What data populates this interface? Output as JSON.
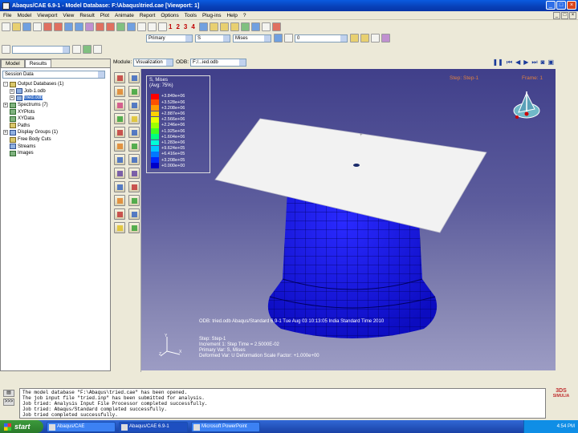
{
  "window": {
    "title": "Abaqus/CAE 6.9-1 - Model Database: F:\\Abaqus\\tried.cae [Viewport: 1]",
    "buttons": [
      "_",
      "□",
      "×"
    ]
  },
  "menu": [
    "File",
    "Model",
    "Viewport",
    "View",
    "Result",
    "Plot",
    "Animate",
    "Report",
    "Options",
    "Tools",
    "Plug-ins",
    "Help",
    "?"
  ],
  "toolbar": {
    "view_numbers": [
      "1",
      "2",
      "3",
      "4"
    ],
    "variable_type": "Primary",
    "field": "S",
    "invariant": "Mises",
    "render_value": "0"
  },
  "context": {
    "module_label": "Module:",
    "module_value": "Visualization",
    "odb_label": "ODB:",
    "odb_value": "F:/...ied.odb"
  },
  "tree": {
    "tabs": [
      "Model",
      "Results"
    ],
    "filter": "Session Data",
    "items": [
      {
        "label": "Output Databases (1)",
        "level": 0,
        "icon": "database-icon"
      },
      {
        "label": "Job-1.odb",
        "level": 1,
        "icon": "odb-icon"
      },
      {
        "label": "tried.odb",
        "level": 1,
        "icon": "odb-icon"
      },
      {
        "label": "Spectrums (7)",
        "level": 0,
        "icon": "spectrum-icon"
      },
      {
        "label": "XYPlots",
        "level": 0,
        "icon": "xyplot-icon"
      },
      {
        "label": "XYData",
        "level": 0,
        "icon": "xydata-icon"
      },
      {
        "label": "Paths",
        "level": 0,
        "icon": "path-icon"
      },
      {
        "label": "Display Groups (1)",
        "level": 0,
        "icon": "display-group-icon"
      },
      {
        "label": "Free Body Cuts",
        "level": 0,
        "icon": "free-body-icon"
      },
      {
        "label": "Streams",
        "level": 0,
        "icon": "stream-icon"
      },
      {
        "label": "Images",
        "level": 0,
        "icon": "image-icon"
      }
    ]
  },
  "legend": {
    "title": "S, Mises",
    "subtitle": "(Avg: 75%)",
    "values": [
      "+3.849e+06",
      "+3.528e+06",
      "+3.208e+06",
      "+2.887e+06",
      "+2.566e+06",
      "+2.246e+06",
      "+1.925e+06",
      "+1.604e+06",
      "+1.283e+06",
      "+9.624e+05",
      "+6.416e+05",
      "+3.208e+05",
      "+0.000e+00"
    ],
    "colors": [
      "#ff0000",
      "#ff5000",
      "#ff9a00",
      "#ffd000",
      "#e8ff00",
      "#9cff00",
      "#40ff20",
      "#00ff80",
      "#00ffd8",
      "#00c8ff",
      "#0078ff",
      "#0028ff",
      "#0000c8"
    ]
  },
  "viewport": {
    "step_label": "Step: Step-1",
    "frame_label": "Frame: 1",
    "odb_info": "ODB: tried.odb    Abaqus/Standard 6.9-1    Tue Aug 03 10:13:05 India Standard Time 2010",
    "step_info": "Step: Step-1",
    "increment_info": "Increment      1: Step Time =    2.5000E-02",
    "primary_var": "Primary Var: S, Mises",
    "deformed_var": "Deformed Var: U   Deformation Scale Factor: +1.000e+00"
  },
  "messages": [
    "The model database \"F:\\Abaqus\\tried.cae\" has been opened.",
    "The job input file \"tried.inp\" has been submitted for analysis.",
    "Job tried: Analysis Input File Processor completed successfully.",
    "Job tried: Abaqus/Standard completed successfully.",
    "Job tried completed successfully."
  ],
  "brand": {
    "logo": "3DS",
    "name": "SIMULIA"
  },
  "taskbar": {
    "start": "start",
    "tasks": [
      "Abaqus/CAE",
      "Abaqus/CAE 6.9-1",
      "Microsoft PowerPoint"
    ],
    "clock": "4:54 PM"
  }
}
